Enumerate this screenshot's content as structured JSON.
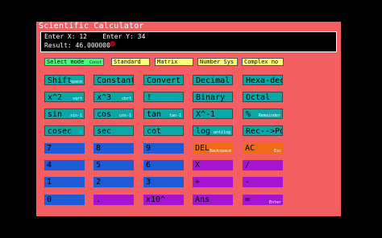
{
  "app": {
    "title": "Scientific Calculator"
  },
  "display": {
    "x_label": "Enter X:",
    "x_value": "12",
    "y_label": "Enter Y:",
    "y_value": "34",
    "result_label": "Result:",
    "result_value": "46.000000"
  },
  "modes": [
    {
      "label": "Select mode",
      "sub": "Const"
    },
    {
      "label": "Standard",
      "sub": ""
    },
    {
      "label": "Matrix",
      "sub": ""
    },
    {
      "label": "Number Sys",
      "sub": ""
    },
    {
      "label": "Complex no",
      "sub": ""
    }
  ],
  "rows": [
    [
      {
        "label": "Shift",
        "sub": "space"
      },
      {
        "label": "Constant",
        "sub": ""
      },
      {
        "label": "Convert",
        "sub": ""
      },
      {
        "label": "Decimal",
        "sub": ""
      },
      {
        "label": "Hexa-dec",
        "sub": ""
      }
    ],
    [
      {
        "label": "x^2",
        "sub": "sqrt"
      },
      {
        "label": "x^3",
        "sub": "cbrt"
      },
      {
        "label": "!",
        "sub": ""
      },
      {
        "label": "Binary",
        "sub": ""
      },
      {
        "label": "Octal",
        "sub": ""
      }
    ],
    [
      {
        "label": "sin",
        "sub": "sin-1"
      },
      {
        "label": "cos",
        "sub": "cos-1"
      },
      {
        "label": "tan",
        "sub": "tan-1"
      },
      {
        "label": "X^-1",
        "sub": ""
      },
      {
        "label": "%",
        "sub": "Remainder"
      }
    ],
    [
      {
        "label": "cosec",
        "sub": ""
      },
      {
        "label": "sec",
        "sub": ""
      },
      {
        "label": "cot",
        "sub": ""
      },
      {
        "label": "log",
        "sub": "antilog"
      },
      {
        "label": "Rec-->Pol",
        "sub": ""
      }
    ],
    [
      {
        "label": "7",
        "sub": ""
      },
      {
        "label": "8",
        "sub": ""
      },
      {
        "label": "9",
        "sub": ""
      },
      {
        "label": "DEL",
        "sub": "Backspace"
      },
      {
        "label": "AC",
        "sub": "Esc"
      }
    ],
    [
      {
        "label": "4",
        "sub": ""
      },
      {
        "label": "5",
        "sub": ""
      },
      {
        "label": "6",
        "sub": ""
      },
      {
        "label": "X",
        "sub": ""
      },
      {
        "label": "/",
        "sub": ""
      }
    ],
    [
      {
        "label": "1",
        "sub": ""
      },
      {
        "label": "2",
        "sub": ""
      },
      {
        "label": "3",
        "sub": ""
      },
      {
        "label": "+",
        "sub": ""
      },
      {
        "label": "-",
        "sub": ""
      }
    ],
    [
      {
        "label": "0",
        "sub": ""
      },
      {
        "label": ".",
        "sub": ""
      },
      {
        "label": "x10^",
        "sub": ""
      },
      {
        "label": "Ans",
        "sub": ""
      },
      {
        "label": "=",
        "sub": "Enter"
      }
    ]
  ],
  "colors": {
    "panel": "#f25e61",
    "teal": "#0aa7a7",
    "blue": "#1d5bd6",
    "purple": "#a514d1",
    "orange": "#ef6b16",
    "yellow": "#ffff7a",
    "green": "#41ff7d"
  }
}
